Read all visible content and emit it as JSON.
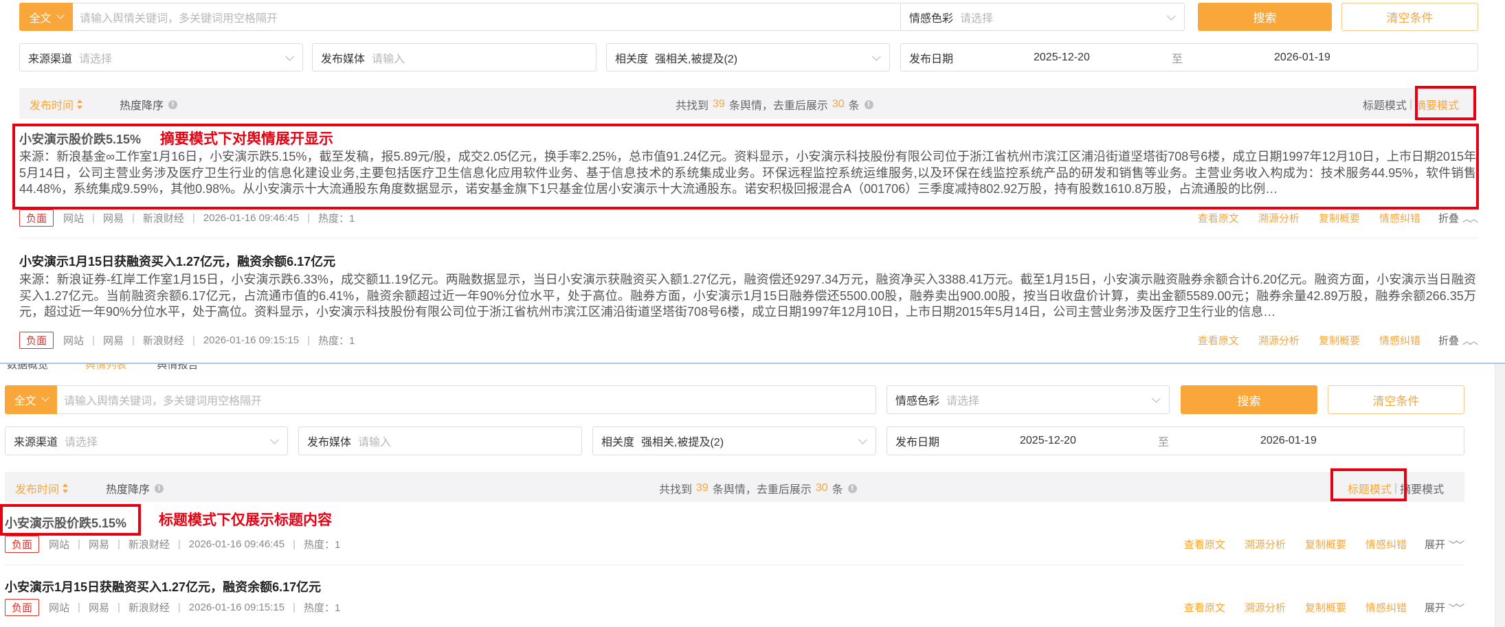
{
  "search": {
    "scope_label": "全文",
    "keyword_placeholder": "请输入舆情关键词，多关键词用空格隔开",
    "sentiment_label": "情感色彩",
    "sentiment_placeholder": "请选择",
    "search_button": "搜索",
    "clear_button": "清空条件",
    "source_label": "来源渠道",
    "source_placeholder": "请选择",
    "media_label": "发布媒体",
    "media_placeholder": "请输入",
    "relevance_label": "相关度",
    "relevance_value": "强相关,被提及(2)",
    "date_label": "发布日期",
    "date_start": "2025-12-20",
    "date_to": "至",
    "date_end": "2026-01-19"
  },
  "sortbar": {
    "time_sort": "发布时间",
    "hot_sort": "热度降序",
    "count_prefix": "共找到",
    "total": "39",
    "count_mid": "条舆情，去重后展示",
    "shown": "30",
    "count_suffix": "条",
    "mode_title": "标题模式",
    "mode_summary": "摘要模式",
    "mode_sep": "|"
  },
  "nav": {
    "tab1": "数据概览",
    "tab2": "舆情列表",
    "tab3": "舆情报告"
  },
  "annotations": {
    "summary_mode": "摘要模式下对舆情展开显示",
    "title_mode": "标题模式下仅展示标题内容"
  },
  "meta_sep": "|",
  "actions": {
    "view": "查看原文",
    "trace": "溯源分析",
    "copy": "复制概要",
    "correct": "情感纠错",
    "collapse": "折叠",
    "expand": "展开"
  },
  "items": [
    {
      "title": "小安演示股价跌5.15%",
      "summary": "来源：新浪基金∞工作室1月16日，小安演示跌5.15%，截至发稿，报5.89元/股，成交2.05亿元，换手率2.25%，总市值91.24亿元。资料显示，小安演示科技股份有限公司位于浙江省杭州市滨江区浦沿街道坚塔街708号6楼，成立日期1997年12月10日，上市日期2015年5月14日，公司主营业务涉及医疗卫生行业的信息化建设业务,主要包括医疗卫生信息化应用软件业务、基于信息技术的系统集成业务。环保远程监控系统运维服务,以及环保在线监控系统产品的研发和销售等业务。主营业务收入构成为：技术服务44.95%，软件销售44.48%，系统集成9.59%，其他0.98%。从小安演示十大流通股东角度数据显示，诺安基金旗下1只基金位居小安演示十大流通股东。诺安积极回报混合A（001706）三季度减持802.92万股，持有股数1610.8万股，占流通股的比例…",
      "sentiment": "负面",
      "source_type": "网站",
      "site": "网易",
      "media": "新浪财经",
      "time": "2026-01-16 09:46:45",
      "heat": "热度：1"
    },
    {
      "title": "小安演示1月15日获融资买入1.27亿元，融资余额6.17亿元",
      "summary": "来源：新浪证券-红岸工作室1月15日，小安演示跌6.33%，成交额11.19亿元。两融数据显示，当日小安演示获融资买入额1.27亿元，融资偿还9297.34万元，融资净买入3388.41万元。截至1月15日，小安演示融资融券余额合计6.20亿元。融资方面，小安演示当日融资买入1.27亿元。当前融资余额6.17亿元，占流通市值的6.41%，融资余额超过近一年90%分位水平，处于高位。融券方面，小安演示1月15日融券偿还5500.00股，融券卖出900.00股，按当日收盘价计算，卖出金额5589.00元；融券余量42.89万股，融券余额266.35万元，超过近一年90%分位水平，处于高位。资料显示，小安演示科技股份有限公司位于浙江省杭州市滨江区浦沿街道坚塔街708号6楼，成立日期1997年12月10日，上市日期2015年5月14日，公司主营业务涉及医疗卫生行业的信息…",
      "sentiment": "负面",
      "source_type": "网站",
      "site": "网易",
      "media": "新浪财经",
      "time": "2026-01-16 09:15:15",
      "heat": "热度：1"
    }
  ],
  "colors": {
    "accent": "#f9a63a",
    "negative": "#e0312a",
    "annotation": "#e60012"
  }
}
